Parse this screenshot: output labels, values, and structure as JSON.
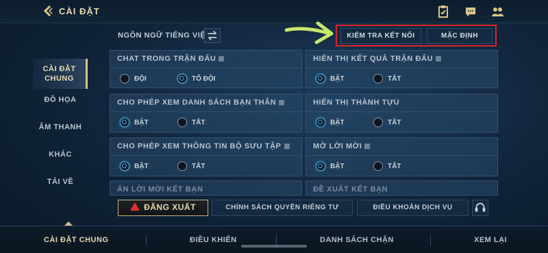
{
  "header": {
    "title": "CÀI ĐẶT",
    "icons": [
      "back-arrow-icon",
      "clipboard-check-icon",
      "chat-icon",
      "friends-icon"
    ]
  },
  "language": {
    "label": "NGÔN NGỮ TIẾNG VIỆT",
    "icon": "swap-icon"
  },
  "top_buttons": {
    "check_connection": "KIỂM TRA KẾT NỐI",
    "default": "MẶC ĐỊNH"
  },
  "sidebar": {
    "items": [
      {
        "label": "CÀI ĐẶT CHUNG",
        "active": true
      },
      {
        "label": "ĐỒ HỌA",
        "active": false
      },
      {
        "label": "ÂM THANH",
        "active": false
      },
      {
        "label": "KHÁC",
        "active": false
      },
      {
        "label": "TẢI VỀ",
        "active": false
      }
    ]
  },
  "settings": [
    {
      "title": "CHAT TRONG TRẬN ĐẤU",
      "options": [
        "ĐỘI",
        "TỔ ĐỘI"
      ],
      "selected": 1
    },
    {
      "title": "HIỂN THỊ KẾT QUẢ TRẬN ĐẤU",
      "options": [
        "BẬT",
        "TẮT"
      ],
      "selected": 0
    },
    {
      "title": "CHO PHÉP XEM DANH SÁCH BẠN THÂN",
      "options": [
        "BẬT",
        "TẮT"
      ],
      "selected": 0
    },
    {
      "title": "HIỂN THỊ THÀNH TỰU",
      "options": [
        "BẬT",
        "TẮT"
      ],
      "selected": 0
    },
    {
      "title": "CHO PHÉP XEM THÔNG TIN BỘ SƯU TẬP",
      "options": [
        "BẬT",
        "TẮT"
      ],
      "selected": 0
    },
    {
      "title": "MỞ LỜI MỜI",
      "options": [
        "BẬT",
        "TẮT"
      ],
      "selected": 0
    },
    {
      "title": "ẨN LỜI MỜI KẾT BẠN",
      "options": [],
      "selected": -1
    },
    {
      "title": "ĐỀ XUẤT KẾT BẠN",
      "options": [],
      "selected": -1
    }
  ],
  "actions": {
    "logout": "ĐĂNG XUẤT",
    "privacy": "CHÍNH SÁCH QUYỀN RIÊNG TƯ",
    "terms": "ĐIỀU KHOẢN DỊCH VỤ"
  },
  "tabs": [
    {
      "label": "CÀI ĐẶT CHUNG",
      "active": true
    },
    {
      "label": "ĐIỀU KHIỂN",
      "active": false
    },
    {
      "label": "DANH SÁCH CHẶN",
      "active": false
    },
    {
      "label": "XEM LẠI",
      "active": false
    }
  ],
  "colors": {
    "accent_gold": "#d8c48a",
    "highlight_red": "#e0232a",
    "arrow_green": "#c8e86a",
    "radio_on": "#4ea8e0"
  }
}
